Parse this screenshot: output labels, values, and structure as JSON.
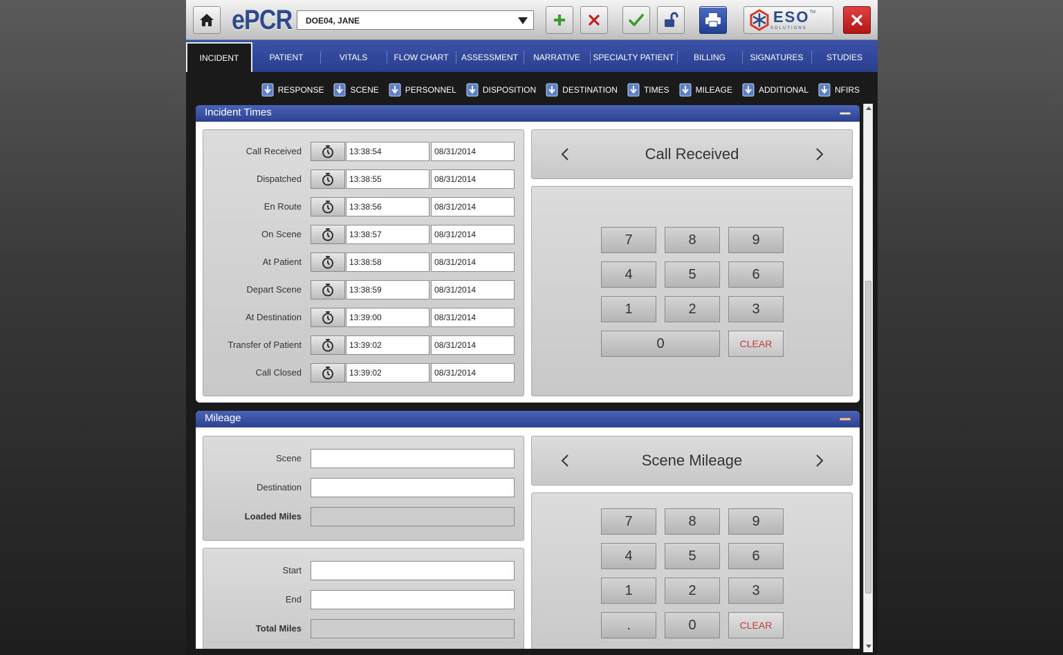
{
  "toolbar": {
    "app_name": "ePCR",
    "patient": "DOE04, JANE",
    "brand": "ESO",
    "brand_sub": "SOLUTIONS",
    "brand_tm": "TM"
  },
  "main_tabs": [
    "INCIDENT",
    "PATIENT",
    "VITALS",
    "FLOW CHART",
    "ASSESSMENT",
    "NARRATIVE",
    "SPECIALTY PATIENT",
    "BILLING",
    "SIGNATURES",
    "STUDIES"
  ],
  "sub_tabs": [
    "RESPONSE",
    "SCENE",
    "PERSONNEL",
    "DISPOSITION",
    "DESTINATION",
    "TIMES",
    "MILEAGE",
    "ADDITIONAL",
    "NFIRS"
  ],
  "incident_times": {
    "title": "Incident Times",
    "rows": [
      {
        "label": "Call Received",
        "time": "13:38:54",
        "date": "08/31/2014"
      },
      {
        "label": "Dispatched",
        "time": "13:38:55",
        "date": "08/31/2014"
      },
      {
        "label": "En Route",
        "time": "13:38:56",
        "date": "08/31/2014"
      },
      {
        "label": "On Scene",
        "time": "13:38:57",
        "date": "08/31/2014"
      },
      {
        "label": "At Patient",
        "time": "13:38:58",
        "date": "08/31/2014"
      },
      {
        "label": "Depart Scene",
        "time": "13:38:59",
        "date": "08/31/2014"
      },
      {
        "label": "At Destination",
        "time": "13:39:00",
        "date": "08/31/2014"
      },
      {
        "label": "Transfer of Patient",
        "time": "13:39:02",
        "date": "08/31/2014"
      },
      {
        "label": "Call Closed",
        "time": "13:39:02",
        "date": "08/31/2014"
      }
    ],
    "nav_title": "Call Received",
    "keypad": [
      "7",
      "8",
      "9",
      "4",
      "5",
      "6",
      "1",
      "2",
      "3",
      "0",
      "CLEAR"
    ]
  },
  "mileage": {
    "title": "Mileage",
    "fields_top": [
      {
        "label": "Scene",
        "value": ""
      },
      {
        "label": "Destination",
        "value": ""
      },
      {
        "label": "Loaded Miles",
        "value": ""
      }
    ],
    "fields_bottom": [
      {
        "label": "Start",
        "value": ""
      },
      {
        "label": "End",
        "value": ""
      },
      {
        "label": "Total Miles",
        "value": ""
      }
    ],
    "nav_title": "Scene Mileage",
    "keypad": [
      "7",
      "8",
      "9",
      "4",
      "5",
      "6",
      "1",
      "2",
      "3",
      ".",
      "0",
      "CLEAR"
    ]
  },
  "colors": {
    "accent": "#2c4290",
    "clear_text": "#c23a3a",
    "add": "#3a9a2a",
    "cancel": "#c02020"
  }
}
